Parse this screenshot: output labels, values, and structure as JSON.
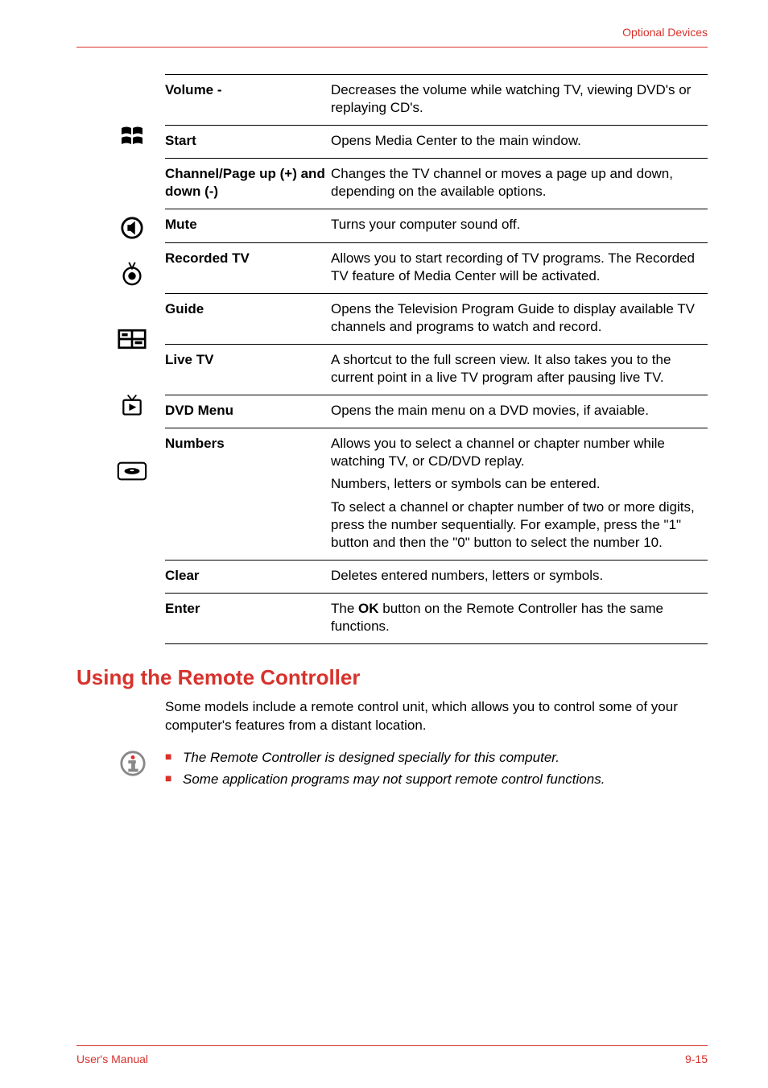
{
  "header": {
    "right_label": "Optional Devices"
  },
  "table": {
    "rows": [
      {
        "term": "Volume -",
        "desc": [
          "Decreases the volume while watching TV, viewing DVD's or replaying CD's."
        ],
        "icon": null
      },
      {
        "term": "Start",
        "desc": [
          "Opens Media Center to the main window."
        ],
        "icon": "windows-logo-icon"
      },
      {
        "term": "Channel/Page up (+) and down (-)",
        "desc": [
          "Changes the TV channel or moves a page up and down, depending on the available options."
        ],
        "icon": null
      },
      {
        "term": "Mute",
        "desc": [
          "Turns your computer sound off."
        ],
        "icon": "mute-icon"
      },
      {
        "term": "Recorded TV",
        "desc": [
          "Allows you to start recording of TV programs. The Recorded TV feature of Media Center will be activated."
        ],
        "icon": "recorded-tv-icon"
      },
      {
        "term": "Guide",
        "desc": [
          "Opens the Television Program Guide to display available TV channels and programs to watch and record."
        ],
        "icon": "guide-icon"
      },
      {
        "term": "Live TV",
        "desc": [
          "A shortcut to the full screen view. It also takes you to the current point in a live TV program after pausing live TV."
        ],
        "icon": "live-tv-icon"
      },
      {
        "term": "DVD Menu",
        "desc": [
          "Opens the main menu on a DVD movies, if avaiable."
        ],
        "icon": "dvd-menu-icon"
      },
      {
        "term": "Numbers",
        "desc": [
          "Allows you to select a channel or chapter number while watching TV, or CD/DVD replay.",
          "Numbers, letters or symbols can be entered.",
          "To select a channel or chapter number of two or more digits, press the number sequentially. For example, press the \"1\" button and then the \"0\" button to select the number 10."
        ],
        "icon": null
      },
      {
        "term": "Clear",
        "desc": [
          "Deletes entered numbers, letters or symbols."
        ],
        "icon": null
      },
      {
        "term": "Enter",
        "desc_prefix": "The ",
        "desc_bold": "OK",
        "desc_suffix": " button on the Remote Controller has the same functions.",
        "icon": null
      }
    ]
  },
  "section": {
    "heading": "Using the Remote Controller",
    "body": "Some models include a remote control unit, which allows you to control some of your computer's features from a distant location.",
    "notes": [
      "The Remote Controller is designed specially for this computer.",
      "Some application programs may not support remote control functions."
    ]
  },
  "footer": {
    "left": "User's Manual",
    "right": "9-15"
  }
}
